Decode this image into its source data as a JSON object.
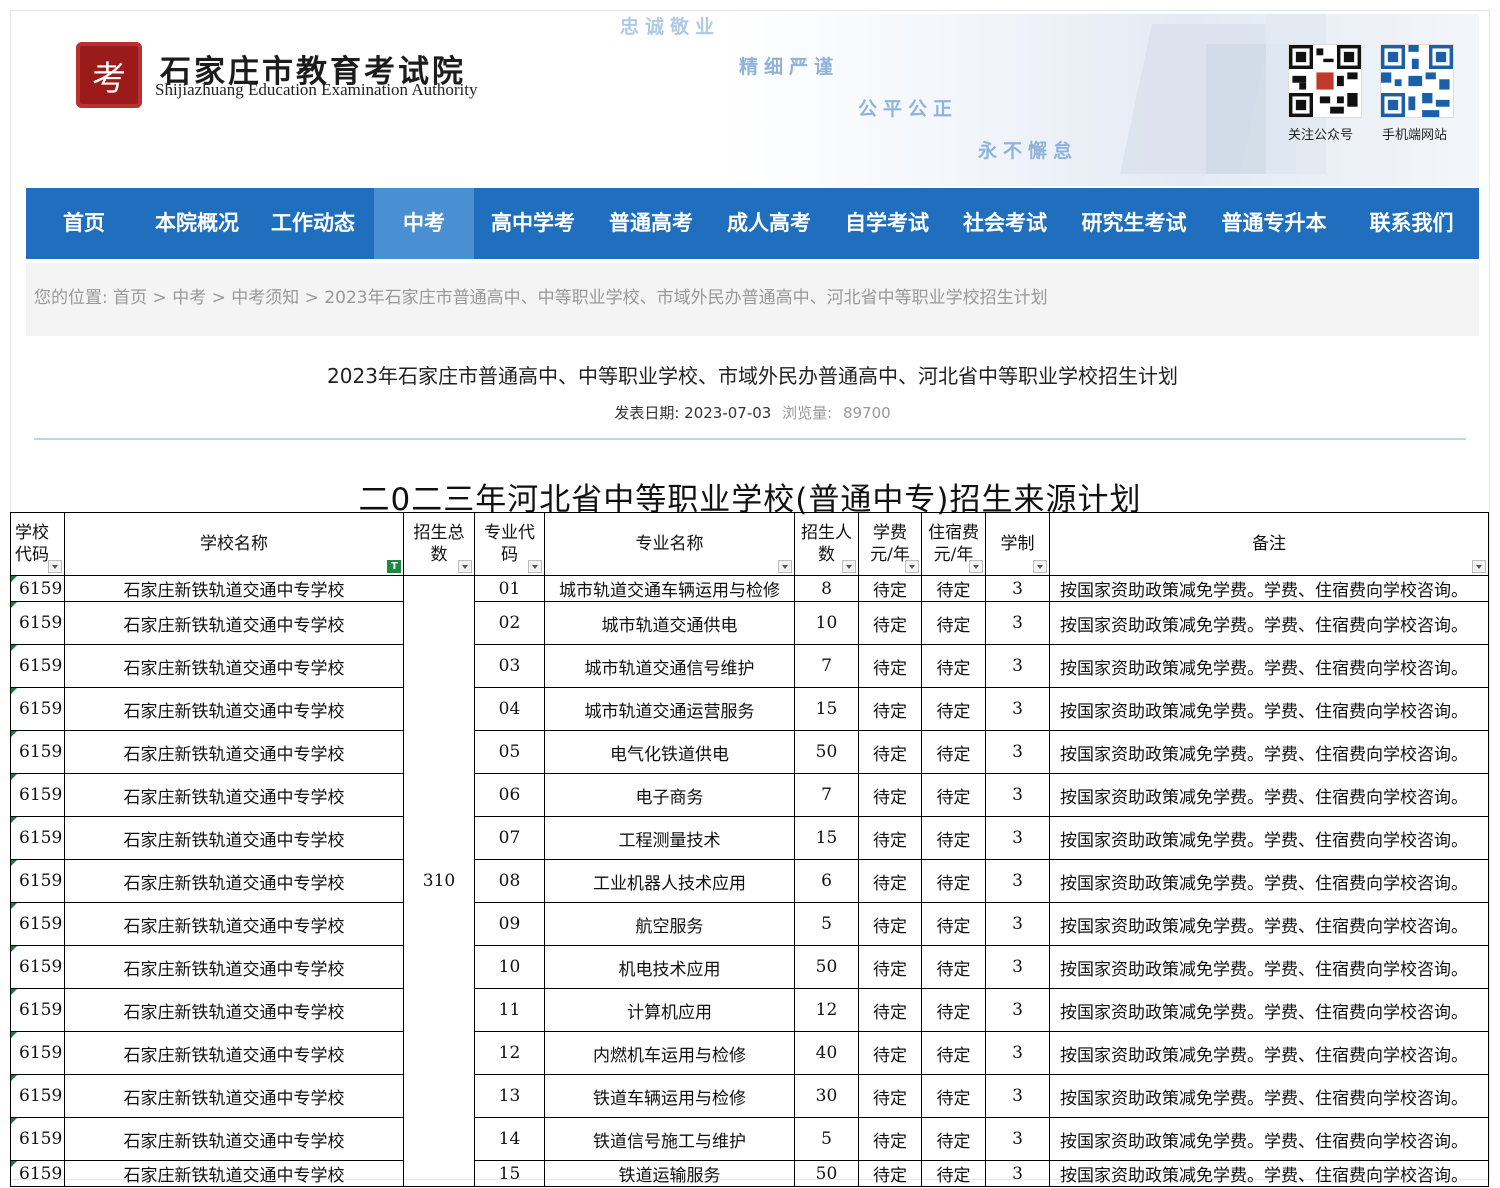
{
  "header": {
    "seal_char": "考",
    "org_name_cn": "石家庄市教育考试院",
    "org_name_en": "Shijiazhuang Education Examination Authority",
    "mottos": [
      "忠诚敬业",
      "精细严谨",
      "公平公正",
      "永不懈怠"
    ],
    "qr_wechat_caption": "关注公众号",
    "qr_mobile_caption": "手机端网站"
  },
  "nav": {
    "items": [
      "首页",
      "本院概况",
      "工作动态",
      "中考",
      "高中学考",
      "普通高考",
      "成人高考",
      "自学考试",
      "社会考试",
      "研究生考试",
      "普通专升本",
      "联系我们"
    ],
    "active": "中考"
  },
  "breadcrumb": {
    "prefix": "您的位置:",
    "links": [
      "首页",
      "中考",
      "中考须知"
    ],
    "current": "2023年石家庄市普通高中、中等职业学校、市域外民办普通高中、河北省中等职业学校招生计划",
    "separator": ">"
  },
  "article": {
    "title": "2023年石家庄市普通高中、中等职业学校、市域外民办普通高中、河北省中等职业学校招生计划",
    "date_label": "发表日期:",
    "date": "2023-07-03",
    "views_label": "浏览量:",
    "views": "89700"
  },
  "sheet": {
    "title": "二0二三年河北省中等职业学校(普通中专)招生来源计划",
    "headers": {
      "school_code": [
        "学校",
        "代码"
      ],
      "school_name": "学校名称",
      "total": [
        "招生总",
        "数"
      ],
      "major_code": [
        "专业代",
        "码"
      ],
      "major_name": "专业名称",
      "enroll": [
        "招生人",
        "数"
      ],
      "tuition": [
        "学费",
        "元/年"
      ],
      "dorm": [
        "住宿费",
        "元/年"
      ],
      "years": "学制",
      "remark": "备注"
    },
    "school_code": "6159",
    "school_name": "石家庄新铁轨道交通中专学校",
    "total": "310",
    "tuition": "待定",
    "dorm": "待定",
    "years": "3",
    "remark": "按国家资助政策减免学费。学费、住宿费向学校咨询。",
    "rows": [
      {
        "major_code": "01",
        "major_name": "城市轨道交通车辆运用与检修",
        "enroll": "8"
      },
      {
        "major_code": "02",
        "major_name": "城市轨道交通供电",
        "enroll": "10"
      },
      {
        "major_code": "03",
        "major_name": "城市轨道交通信号维护",
        "enroll": "7"
      },
      {
        "major_code": "04",
        "major_name": "城市轨道交通运营服务",
        "enroll": "15"
      },
      {
        "major_code": "05",
        "major_name": "电气化铁道供电",
        "enroll": "50"
      },
      {
        "major_code": "06",
        "major_name": "电子商务",
        "enroll": "7"
      },
      {
        "major_code": "07",
        "major_name": "工程测量技术",
        "enroll": "15"
      },
      {
        "major_code": "08",
        "major_name": "工业机器人技术应用",
        "enroll": "6"
      },
      {
        "major_code": "09",
        "major_name": "航空服务",
        "enroll": "5"
      },
      {
        "major_code": "10",
        "major_name": "机电技术应用",
        "enroll": "50"
      },
      {
        "major_code": "11",
        "major_name": "计算机应用",
        "enroll": "12"
      },
      {
        "major_code": "12",
        "major_name": "内燃机车运用与检修",
        "enroll": "40"
      },
      {
        "major_code": "13",
        "major_name": "铁道车辆运用与检修",
        "enroll": "30"
      },
      {
        "major_code": "14",
        "major_name": "铁道信号施工与维护",
        "enroll": "5"
      },
      {
        "major_code": "15",
        "major_name": "铁道运输服务",
        "enroll": "50"
      }
    ]
  },
  "colors": {
    "nav_bg": "#1f6fbe",
    "nav_active": "#4b8fd3",
    "motto": "#8fb3da",
    "seal": "#9b1b1b",
    "filter_active": "#1b8a3e"
  }
}
